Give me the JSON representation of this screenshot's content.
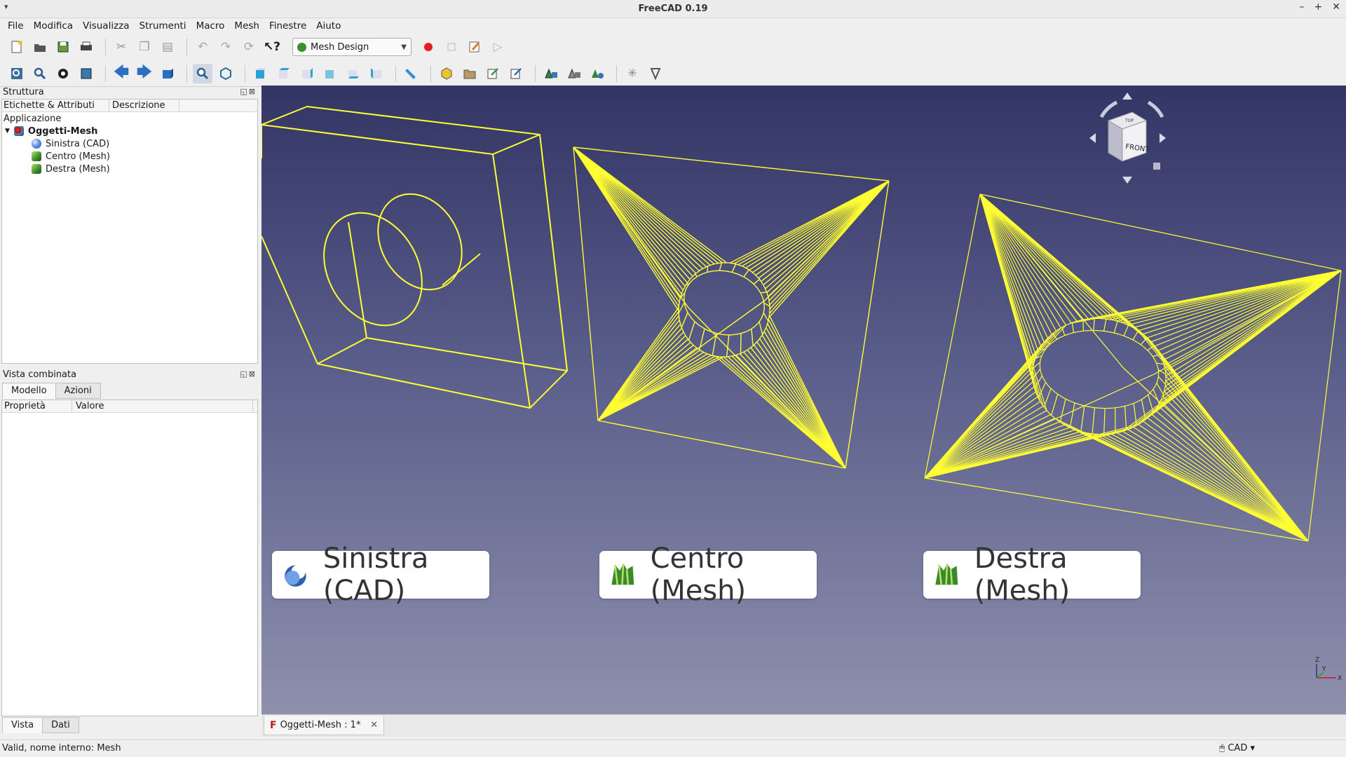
{
  "window": {
    "title": "FreeCAD 0.19"
  },
  "menu": [
    "File",
    "Modifica",
    "Visualizza",
    "Strumenti",
    "Macro",
    "Mesh",
    "Finestre",
    "Aiuto"
  ],
  "toolbar": {
    "workbench": "Mesh Design"
  },
  "tree_panel": {
    "title": "Struttura",
    "col_labels": "Etichette & Attributi",
    "col_description": "Descrizione",
    "group": "Applicazione",
    "document": "Oggetti-Mesh",
    "items": [
      "Sinistra (CAD)",
      "Centro (Mesh)",
      "Destra (Mesh)"
    ]
  },
  "combo_panel": {
    "title": "Vista combinata",
    "tabs": [
      "Modello",
      "Azioni"
    ],
    "col_property": "Proprietà",
    "col_value": "Valore",
    "bottom_tabs": [
      "Vista",
      "Dati"
    ]
  },
  "viewport": {
    "labels": [
      "Sinistra (CAD)",
      "Centro (Mesh)",
      "Destra (Mesh)"
    ],
    "navcube_face": "FRONT",
    "navcube_top": "TOP",
    "axes": [
      "X",
      "Y",
      "Z"
    ],
    "mesh_color": "#ffff33",
    "bg_top": "#333565",
    "bg_bottom": "#8e90ad"
  },
  "doc_tab": {
    "label": "Oggetti-Mesh : 1*"
  },
  "status": {
    "message": "Valid, nome interno: Mesh",
    "nav_style": "CAD"
  }
}
